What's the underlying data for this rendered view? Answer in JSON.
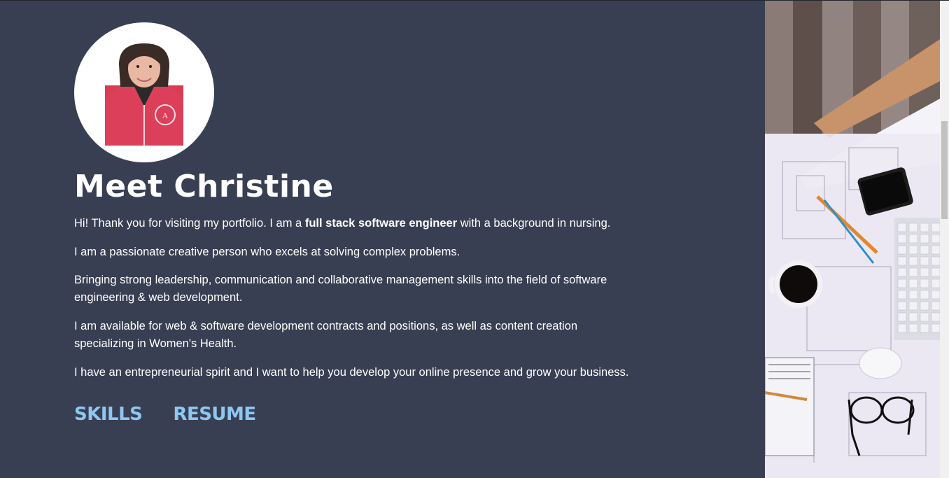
{
  "profile": {
    "avatar_alt": "Christine",
    "heading": "Meet Christine",
    "intro_before": "Hi! Thank you for visiting my portfolio. I am a ",
    "intro_bold": "full stack software engineer",
    "intro_after": " with a background in nursing.",
    "p2": "I am a passionate creative person who excels at solving complex problems.",
    "p3": "Bringing strong leadership, communication and collaborative management skills into the field of software engineering & web development.",
    "p4": "I am available for web & software development contracts and positions, as well as content creation specializing in Women's Health.",
    "p5": "I have an entrepreneurial spirit and I want to help you develop your online presence and grow your business."
  },
  "links": {
    "skills": "SKILLS",
    "resume": "RESUME"
  },
  "colors": {
    "background": "#393f52",
    "text": "#ffffff",
    "link": "#8ec7f2"
  }
}
